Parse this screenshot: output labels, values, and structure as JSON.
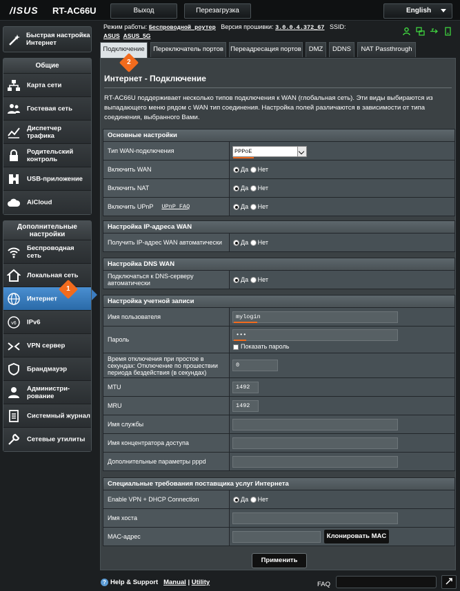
{
  "header": {
    "brand": "/ISUS",
    "model": "RT-AC66U",
    "logout_label": "Выход",
    "reboot_label": "Перезагрузка",
    "language": "English"
  },
  "status": {
    "mode_label": "Режим работы:",
    "mode_value": "Беспроводной роутер",
    "firmware_label": "Версия прошивки:",
    "firmware_value": "3.0.0.4.372_67",
    "ssid_label": "SSID:",
    "ssid_1": "ASUS",
    "ssid_2": "ASUS_5G"
  },
  "sidebar": {
    "quick_setup": "Быстрая настройка Интернет",
    "general_title": "Общие",
    "general_items": [
      {
        "label": "Карта сети",
        "icon": "network-map-icon"
      },
      {
        "label": "Гостевая сеть",
        "icon": "guest-network-icon"
      },
      {
        "label": "Диспетчер трафика",
        "icon": "traffic-manager-icon"
      },
      {
        "label": "Родительский контроль",
        "icon": "parental-control-icon"
      },
      {
        "label": "USB-приложение",
        "icon": "usb-app-icon"
      },
      {
        "label": "AiCloud",
        "icon": "aicloud-icon"
      }
    ],
    "advanced_title": "Дополнительные настройки",
    "advanced_items": [
      {
        "label": "Беспроводная сеть",
        "icon": "wifi-icon"
      },
      {
        "label": "Локальная сеть",
        "icon": "home-icon"
      },
      {
        "label": "Интернет",
        "icon": "globe-icon"
      },
      {
        "label": "IPv6",
        "icon": "ipv6-icon"
      },
      {
        "label": "VPN сервер",
        "icon": "vpn-icon"
      },
      {
        "label": "Брандмауэр",
        "icon": "firewall-icon"
      },
      {
        "label": "Администри-рование",
        "icon": "admin-icon"
      },
      {
        "label": "Системный журнал",
        "icon": "log-icon"
      },
      {
        "label": "Сетевые утилиты",
        "icon": "tools-icon"
      }
    ]
  },
  "tabs": [
    "Подключение",
    "Переключатель портов",
    "Переадресация портов",
    "DMZ",
    "DDNS",
    "NAT Passthrough"
  ],
  "panel": {
    "title": "Интернет - Подключение",
    "description": "RT-AC66U поддерживает несколько типов подключения к WAN (глобальная сеть). Эти виды выбираются из выпадающего меню рядом с WAN тип соединения. Настройка полей различаются в зависимости от типа соединения, выбранного Вами."
  },
  "radio": {
    "yes": "Да",
    "no": "Нет"
  },
  "basic": {
    "title": "Основные настройки",
    "wan_type_label": "Тип WAN-подключения",
    "wan_type_value": "PPPoE",
    "enable_wan_label": "Включить WAN",
    "enable_nat_label": "Включить NAT",
    "enable_upnp_label": "Включить UPnP",
    "upnp_faq": "UPnP FAQ"
  },
  "wanip": {
    "title": "Настройка IP-адреса WAN",
    "auto_ip_label": "Получить IP-адрес WAN автоматически"
  },
  "dns": {
    "title": "Настройка DNS WAN",
    "auto_dns_label": "Подключаться к DNS-серверу автоматически"
  },
  "account": {
    "title": "Настройка учетной записи",
    "username_label": "Имя пользователя",
    "username_value": "mylogin",
    "password_label": "Пароль",
    "password_value": "•••",
    "show_password": "Показать пароль",
    "idle_label": "Время отключения при простое в секундах: Отключение по прошествии периода бездействия (в секундах)",
    "idle_value": "0",
    "mtu_label": "MTU",
    "mtu_value": "1492",
    "mru_label": "MRU",
    "mru_value": "1492",
    "service_label": "Имя службы",
    "ac_label": "Имя концентратора доступа",
    "pppd_label": "Дополнительные параметры pppd"
  },
  "isp": {
    "title": "Специальные требования поставщика услуг Интернета",
    "vpn_dhcp_label": "Enable VPN + DHCP Connection",
    "hostname_label": "Имя хоста",
    "mac_label": "MAC-адрес",
    "clone_mac": "Клонировать MAC"
  },
  "apply_label": "Применить",
  "footer": {
    "help": "Help & Support",
    "manual": "Manual",
    "sep": "|",
    "utility": "Utility",
    "faq": "FAQ"
  },
  "markers": {
    "m1": "1",
    "m2": "2"
  },
  "colors": {
    "accent": "#f26b1d",
    "active": "#3b7cc0",
    "bg": "#1c1f21"
  }
}
